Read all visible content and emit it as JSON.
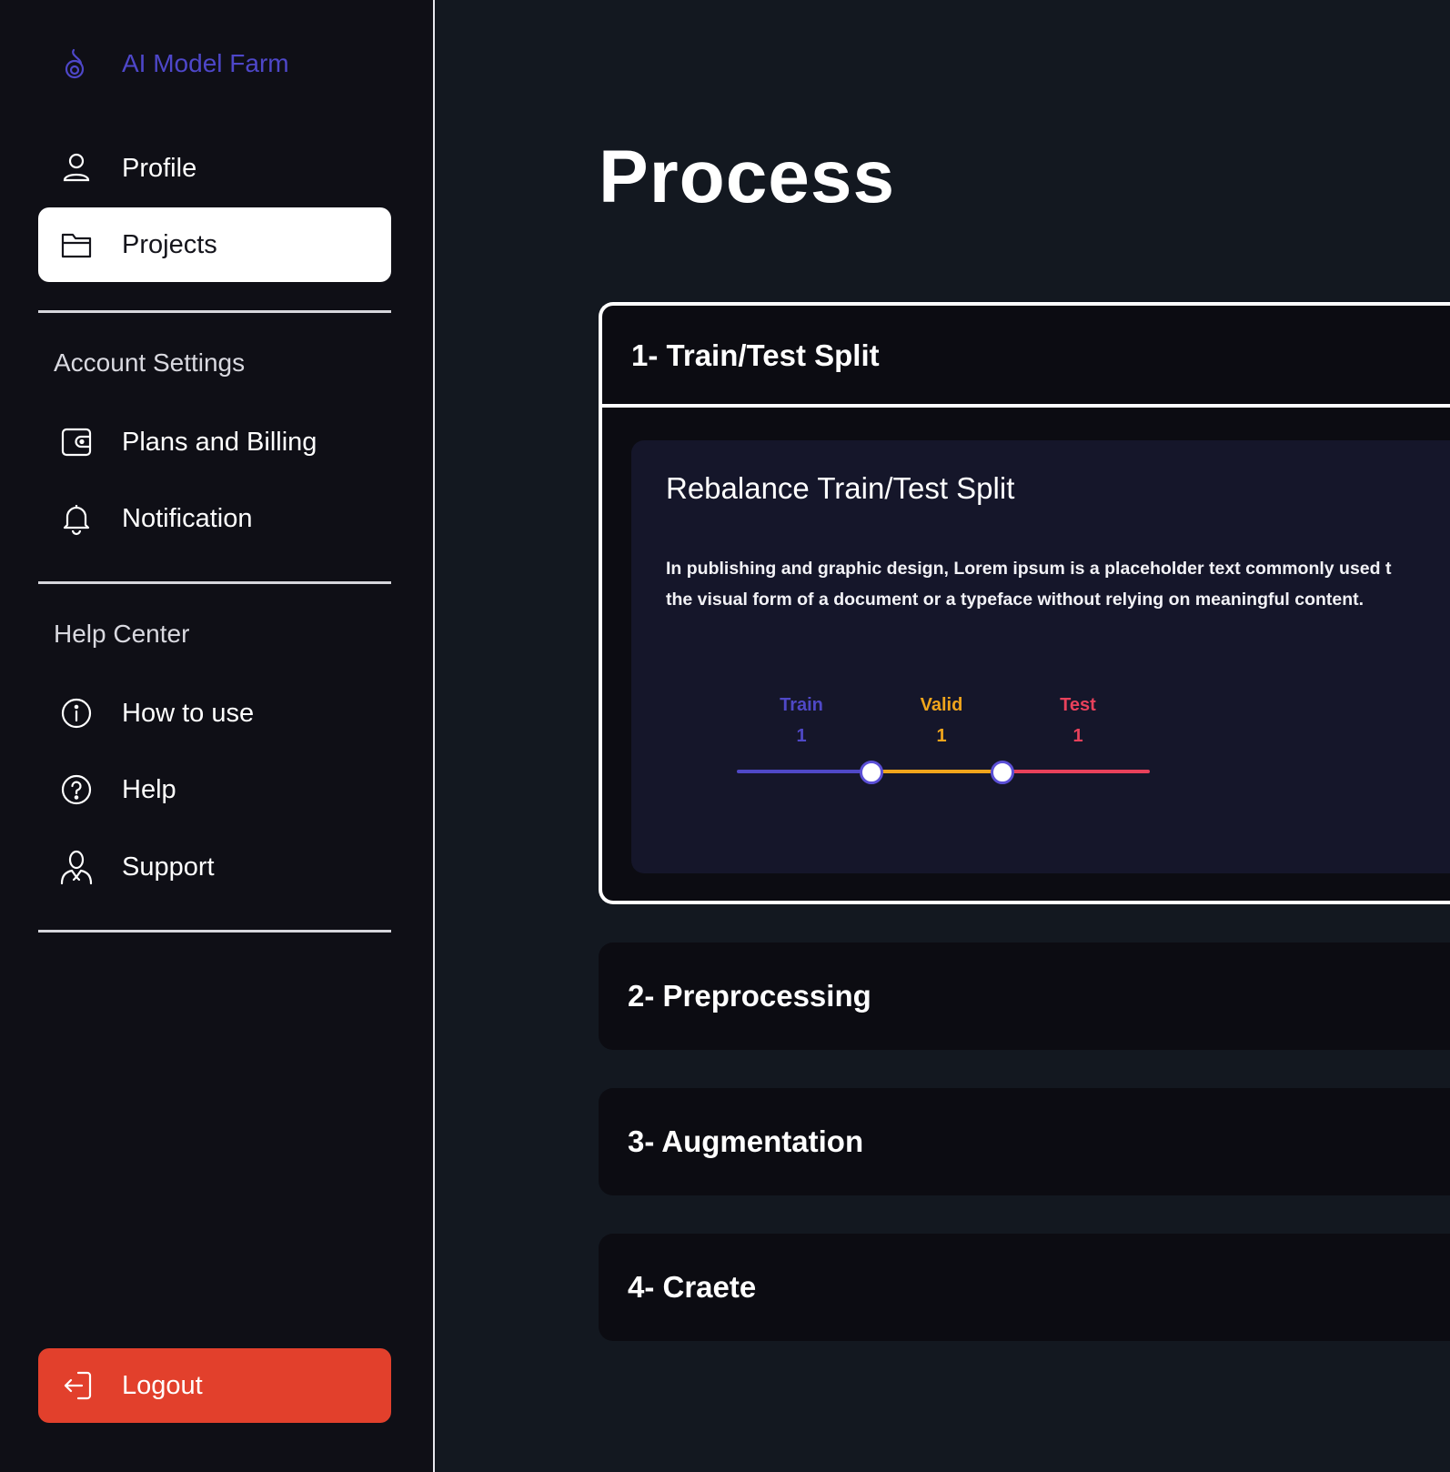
{
  "brand": {
    "name": "AI Model Farm",
    "icon": "flame-icon",
    "color": "#4e47c9"
  },
  "sidebar": {
    "main_items": [
      {
        "label": "Profile",
        "icon": "user-icon"
      },
      {
        "label": "Projects",
        "icon": "folder-icon",
        "active": true
      }
    ],
    "account_settings": {
      "title": "Account Settings",
      "items": [
        {
          "label": "Plans and Billing",
          "icon": "wallet-icon"
        },
        {
          "label": "Notification",
          "icon": "bell-icon"
        }
      ]
    },
    "help_center": {
      "title": "Help Center",
      "items": [
        {
          "label": "How to use",
          "icon": "info-icon"
        },
        {
          "label": "Help",
          "icon": "question-icon"
        },
        {
          "label": "Support",
          "icon": "support-agent-icon"
        }
      ]
    },
    "logout": {
      "label": "Logout",
      "icon": "logout-icon",
      "color": "#e2402c"
    }
  },
  "main": {
    "title": "Process",
    "steps": [
      {
        "title": "1- Train/Test Split",
        "expanded": true,
        "panel": {
          "title": "Rebalance Train/Test Split",
          "description_line1": "In publishing and graphic design, Lorem ipsum is a placeholder text commonly used t",
          "description_line2": "the visual form of a document or a typeface without relying on meaningful content.",
          "split": [
            {
              "label": "Train",
              "value": "1",
              "color": "#4f48c7"
            },
            {
              "label": "Valid",
              "value": "1",
              "color": "#f0a51c"
            },
            {
              "label": "Test",
              "value": "1",
              "color": "#e8415b"
            }
          ]
        }
      },
      {
        "title": "2- Preprocessing",
        "expanded": false
      },
      {
        "title": "3- Augmentation",
        "expanded": false
      },
      {
        "title": "4- Craete",
        "expanded": false
      }
    ]
  }
}
